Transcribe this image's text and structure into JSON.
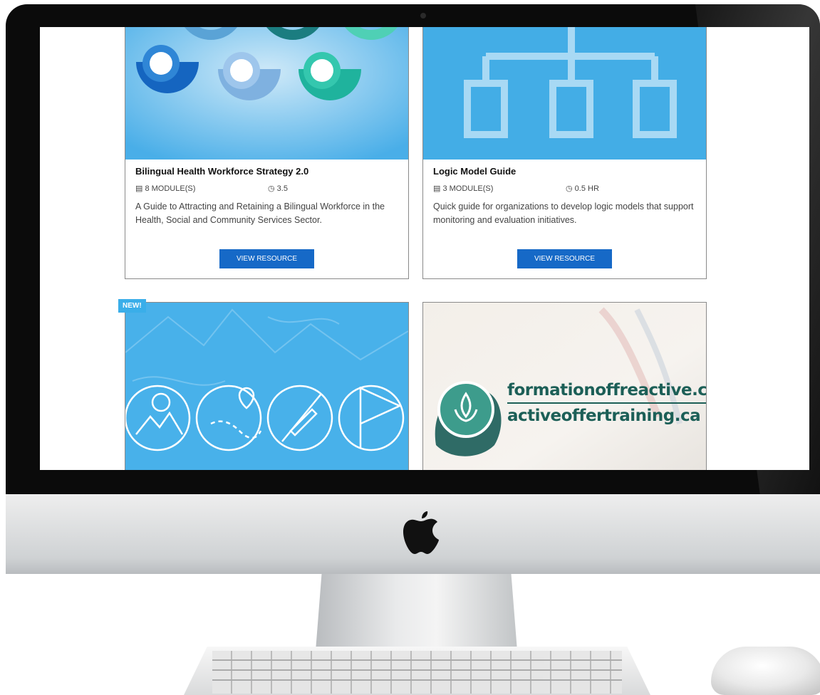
{
  "cards": [
    {
      "title": "Bilingual Health Workforce Strategy 2.0",
      "modules": "8 MODULE(S)",
      "duration": "3.5",
      "description": "A Guide to Attracting and Retaining a Bilingual Workforce in the Health, Social and Community Services Sector.",
      "button": "VIEW RESOURCE"
    },
    {
      "title": "Logic Model Guide",
      "modules": "3 MODULE(S)",
      "duration": "0.5 HR",
      "description": "Quick guide for organizations to develop logic models that support monitoring and evaluation initiatives.",
      "button": "VIEW RESOURCE"
    },
    {
      "badge": "NEW!"
    },
    {
      "logo_text_1": "formationoffreactive.ca",
      "logo_text_2": "activeoffertraining.ca"
    }
  ],
  "icons": {
    "module": "document-icon",
    "time": "clock-icon",
    "hardware_logo": "apple-logo"
  },
  "colors": {
    "accent_blue": "#3aaee9",
    "button_blue": "#1669c7",
    "logo_green": "#1c5f57"
  }
}
